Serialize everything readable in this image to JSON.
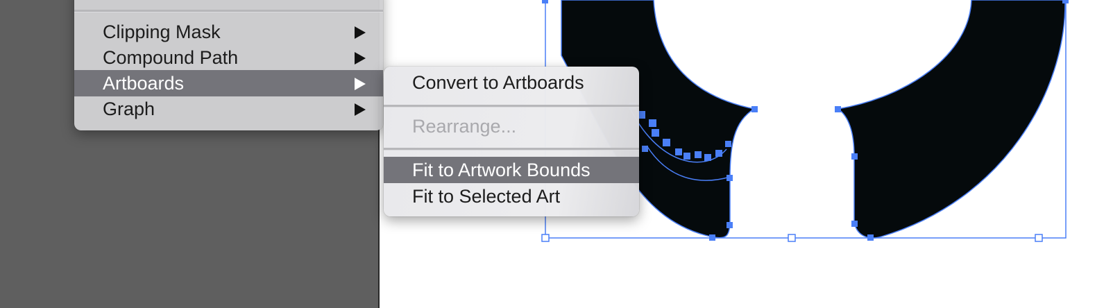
{
  "main_menu": {
    "items": [
      {
        "label": "Clipping Mask",
        "has_submenu": true,
        "highlighted": false
      },
      {
        "label": "Compound Path",
        "has_submenu": true,
        "highlighted": false
      },
      {
        "label": "Artboards",
        "has_submenu": true,
        "highlighted": true
      },
      {
        "label": "Graph",
        "has_submenu": true,
        "highlighted": false
      }
    ]
  },
  "artboards_submenu": {
    "convert": "Convert to Artboards",
    "rearrange": "Rearrange...",
    "fit_artwork": "Fit to Artwork Bounds",
    "fit_selected": "Fit to Selected Art",
    "highlighted_item": "Fit to Artwork Bounds",
    "disabled_item": "Rearrange..."
  },
  "icons": {
    "submenu_arrow": "triangle-right-icon",
    "anchor_point": "square-anchor-icon"
  },
  "colors": {
    "left_panel": "#5f5f5f",
    "menu_background": "#d0d0d2",
    "submenu_background": "#e8e8eb",
    "menu_highlight": "#74747a",
    "disabled_text": "#a9a9ad",
    "selection_blue": "#4a7ff7",
    "artwork_fill": "#050a0c"
  }
}
